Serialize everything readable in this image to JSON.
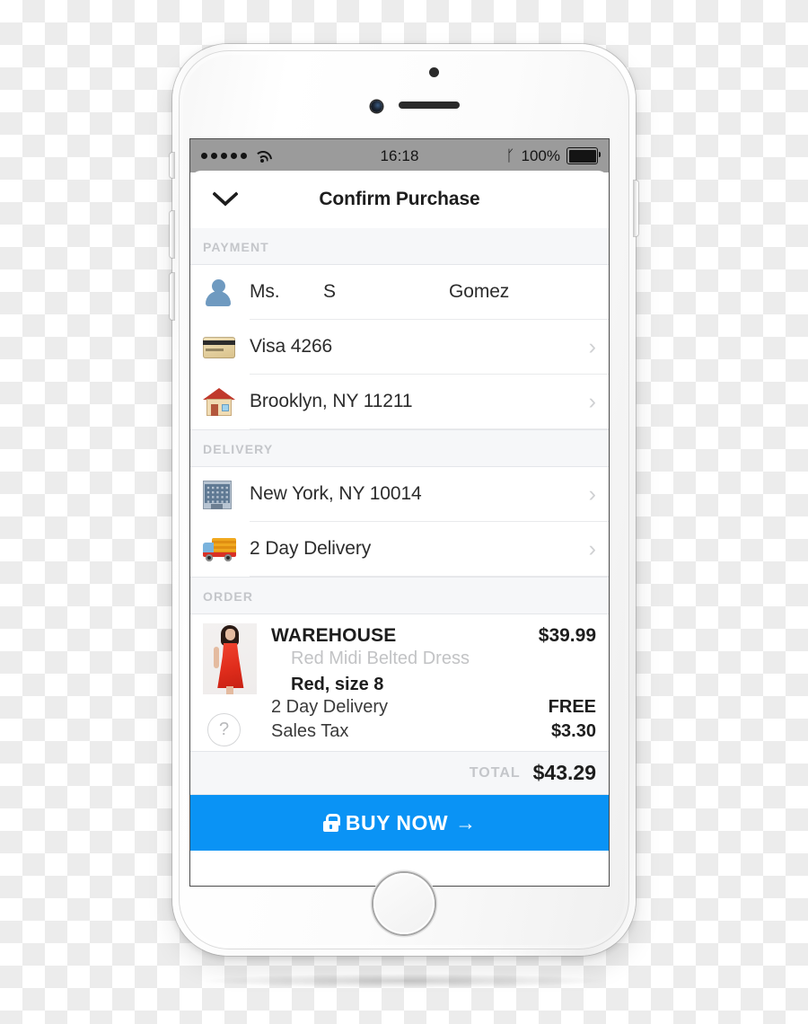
{
  "statusbar": {
    "signal_dots": 5,
    "wifi_icon": "wifi-icon",
    "time": "16:18",
    "bluetooth_icon": "bluetooth-icon",
    "battery_percent": "100%",
    "battery_icon": "battery-full-icon"
  },
  "navbar": {
    "back_icon": "chevron-down-icon",
    "title": "Confirm Purchase"
  },
  "sections": {
    "payment": {
      "header": "PAYMENT",
      "name_row": {
        "icon": "person-avatar-icon",
        "title": "Ms.",
        "middle": "S",
        "last": "Gomez"
      },
      "card_row": {
        "icon": "credit-card-icon",
        "label": "Visa 4266",
        "chevron": "chevron-right-icon"
      },
      "billing_row": {
        "icon": "house-icon",
        "label": "Brooklyn, NY 11211",
        "chevron": "chevron-right-icon"
      }
    },
    "delivery": {
      "header": "DELIVERY",
      "address_row": {
        "icon": "office-building-icon",
        "label": "New York, NY 10014",
        "chevron": "chevron-right-icon"
      },
      "speed_row": {
        "icon": "delivery-truck-icon",
        "label": "2 Day Delivery",
        "chevron": "chevron-right-icon"
      }
    },
    "order": {
      "header": "ORDER",
      "thumbnail": "red-dress-product-thumbnail",
      "help_icon": "question-mark-icon",
      "brand": "WAREHOUSE",
      "price": "$39.99",
      "description": "Red Midi Belted Dress",
      "variant": "Red, size 8",
      "lines": [
        {
          "label": "2 Day Delivery",
          "value": "FREE"
        },
        {
          "label": "Sales Tax",
          "value": "$3.30"
        }
      ],
      "total_label": "TOTAL",
      "total_value": "$43.29"
    }
  },
  "buy": {
    "lock_icon": "lock-icon",
    "label": "BUY NOW",
    "arrow_icon": "arrow-right-icon",
    "arrow_glyph": "→",
    "color": "#0a93f5"
  },
  "colors": {
    "accent": "#0a93f5",
    "section_header_text": "#c4c6ca",
    "section_header_bg": "#f6f7f9",
    "primary_text": "#1d1d1d",
    "muted_text": "#c2c3c5",
    "statusbar_bg": "#9b9b9b"
  }
}
